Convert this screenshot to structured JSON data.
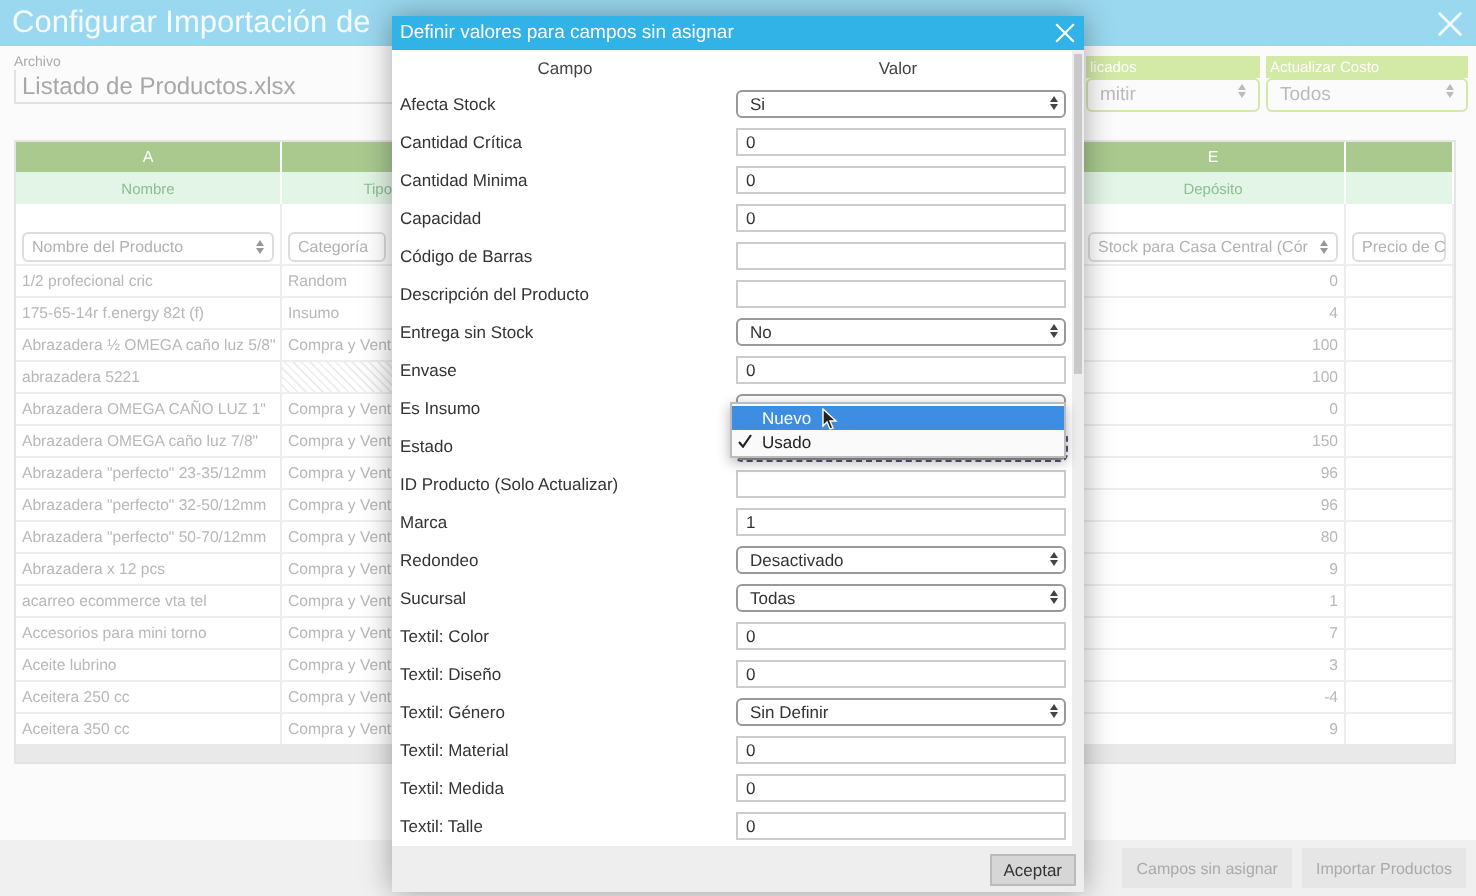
{
  "window": {
    "title": "Configurar Importación de"
  },
  "file": {
    "label": "Archivo",
    "value": "Listado de Productos.xlsx"
  },
  "filters": [
    {
      "label": "licados",
      "value": "mitir"
    },
    {
      "label": "Actualizar Costo",
      "value": "Todos"
    }
  ],
  "table": {
    "columns": [
      {
        "letter": "A",
        "name": "Nombre",
        "select": "Nombre del Producto"
      },
      {
        "name": "Tipo",
        "select": "Categoría"
      },
      {
        "letter": "E",
        "name": "Depósito",
        "select": "Stock para Casa Central (Cór"
      },
      {
        "select": "Precio de C"
      }
    ],
    "rows": [
      {
        "name": "1/2 profecional cric",
        "type": "Random",
        "stock": "0"
      },
      {
        "name": "175-65-14r f.energy 82t (f)",
        "type": "Insumo",
        "stock": "4"
      },
      {
        "name": "Abrazadera ½ OMEGA caño luz 5/8\"",
        "type": "Compra y Vent",
        "stock": "100"
      },
      {
        "name": "abrazadera 5221",
        "stock": "100"
      },
      {
        "name": "Abrazadera OMEGA CAÑO LUZ 1\"",
        "type": "Compra y Vent",
        "stock": "0"
      },
      {
        "name": "Abrazadera OMEGA caño luz 7/8\"",
        "type": "Compra y Vent",
        "stock": "150"
      },
      {
        "name": "Abrazadera \"perfecto\" 23-35/12mm",
        "type": "Compra y Vent",
        "stock": "96"
      },
      {
        "name": "Abrazadera \"perfecto\" 32-50/12mm",
        "type": "Compra y Vent",
        "stock": "96"
      },
      {
        "name": "Abrazadera \"perfecto\" 50-70/12mm",
        "type": "Compra y Vent",
        "stock": "80"
      },
      {
        "name": "Abrazadera x 12 pcs",
        "type": "Compra y Vent",
        "stock": "9"
      },
      {
        "name": "acarreo ecommerce vta tel",
        "type": "Compra y Vent",
        "stock": "1"
      },
      {
        "name": "Accesorios para mini torno",
        "type": "Compra y Vent",
        "stock": "7"
      },
      {
        "name": "Aceite lubrino",
        "type": "Compra y Vent",
        "stock": "3"
      },
      {
        "name": "Aceitera 250 cc",
        "type": "Compra y Vent",
        "stock": "-4"
      },
      {
        "name": "Aceitera 350 cc",
        "type": "Compra y Vent",
        "stock": "9"
      }
    ]
  },
  "footer_buttons": [
    "Campos sin asignar",
    "Importar Productos"
  ],
  "dialog": {
    "title": "Definir valores para campos sin asignar",
    "headers": [
      "Campo",
      "Valor"
    ],
    "fields": [
      {
        "label": "Afecta Stock",
        "kind": "select",
        "value": "Si"
      },
      {
        "label": "Cantidad Crítica",
        "kind": "input",
        "value": "0"
      },
      {
        "label": "Cantidad Minima",
        "kind": "input",
        "value": "0"
      },
      {
        "label": "Capacidad",
        "kind": "input",
        "value": "0"
      },
      {
        "label": "Código de Barras",
        "kind": "input"
      },
      {
        "label": "Descripción del Producto",
        "kind": "input"
      },
      {
        "label": "Entrega sin Stock",
        "kind": "select",
        "value": "No"
      },
      {
        "label": "Envase",
        "kind": "input",
        "value": "0"
      },
      {
        "label": "Es Insumo",
        "kind": "select"
      },
      {
        "label": "Estado",
        "kind": "select",
        "options": [
          {
            "label": "Nuevo",
            "highlighted": true,
            "checked": false
          },
          {
            "label": "Usado",
            "highlighted": false,
            "checked": true
          }
        ]
      },
      {
        "label": "ID Producto (Solo Actualizar)",
        "kind": "input"
      },
      {
        "label": "Marca",
        "kind": "input",
        "value": "1"
      },
      {
        "label": "Redondeo",
        "kind": "select",
        "value": "Desactivado"
      },
      {
        "label": "Sucursal",
        "kind": "select",
        "value": "Todas"
      },
      {
        "label": "Textil: Color",
        "kind": "input",
        "value": "0"
      },
      {
        "label": "Textil: Diseño",
        "kind": "input",
        "value": "0"
      },
      {
        "label": "Textil: Género",
        "kind": "select",
        "value": "Sin Definir"
      },
      {
        "label": "Textil: Material",
        "kind": "input",
        "value": "0"
      },
      {
        "label": "Textil: Medida",
        "kind": "input",
        "value": "0"
      },
      {
        "label": "Textil: Talle",
        "kind": "input",
        "value": "0"
      }
    ],
    "button": "Aceptar"
  }
}
